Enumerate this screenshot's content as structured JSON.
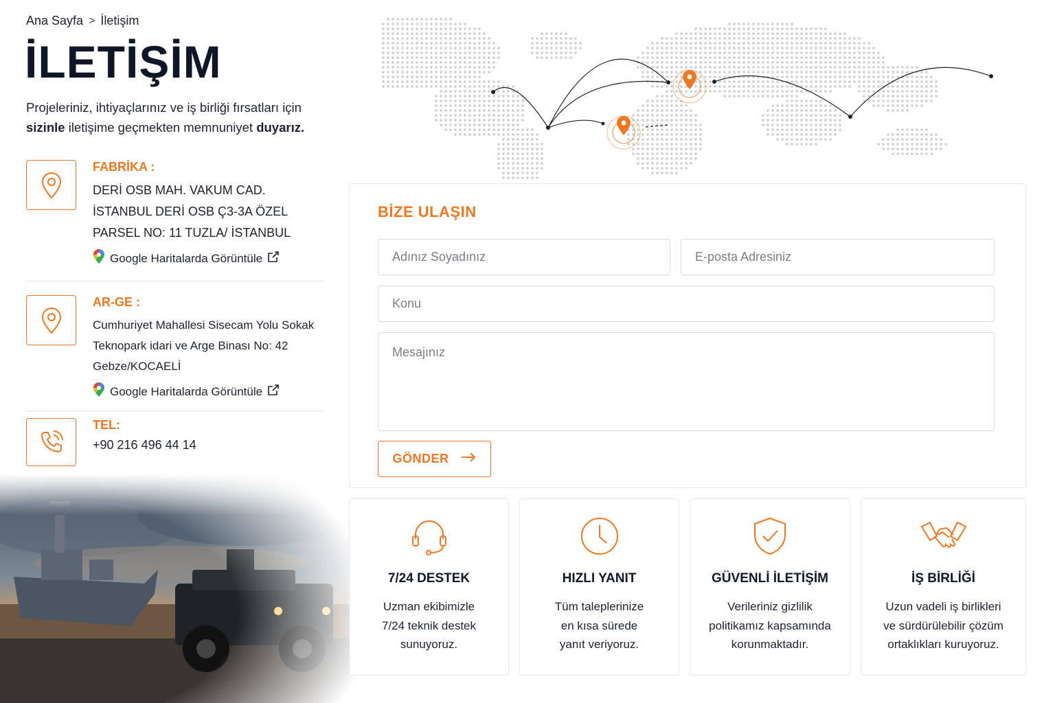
{
  "breadcrumb": {
    "home": "Ana Sayfa",
    "separator": ">",
    "current": "İletişim"
  },
  "page": {
    "title": "İLETİŞİM",
    "intro_line1": "Projeleriniz, ihtiyaçlarınız ve iş birliği fırsatları için",
    "intro_bold1": "sizinle",
    "intro_mid": "iletişime geçmekten memnuniyet",
    "intro_bold2": "duyarız."
  },
  "contacts": {
    "factory": {
      "icon": "location-pin-icon",
      "label": "FABRİKA :",
      "lines": [
        "DERİ OSB MAH. VAKUM CAD.",
        "İSTANBUL DERİ OSB Ç3-3A ÖZEL",
        "PARSEL NO: 11 TUZLA/ İSTANBUL"
      ],
      "maps_link": "Google Haritalarda Görüntüle"
    },
    "rnd": {
      "icon": "location-pin-icon",
      "label": "AR-GE :",
      "lines": [
        "Cumhuriyet Mahallesi Sisecam Yolu Sokak",
        "Teknopark idari ve Arge Binası No: 42",
        "Gebze/KOCAELİ"
      ],
      "maps_link": "Google Haritalarda Görüntüle"
    },
    "phone": {
      "icon": "phone-icon",
      "label": "TEL:",
      "number": "+90 216 496 44 14"
    }
  },
  "form": {
    "title": "BİZE ULAŞIN",
    "name_placeholder": "Adınız Soyadınız",
    "email_placeholder": "E-posta Adresiniz",
    "subject_placeholder": "Konu",
    "message_placeholder": "Mesajınız",
    "submit_label": "GÖNDER"
  },
  "features": [
    {
      "icon": "headset-icon",
      "title": "7/24 DESTEK",
      "lines": [
        "Uzman ekibimizle",
        "7/24 teknik destek",
        "sunuyoruz."
      ]
    },
    {
      "icon": "clock-icon",
      "title": "HIZLI YANIT",
      "lines": [
        "Tüm taleplerinize",
        "en kısa sürede",
        "yanıt veriyoruz."
      ]
    },
    {
      "icon": "shield-check-icon",
      "title": "GÜVENLİ İLETİŞİM",
      "lines": [
        "Verileriniz gizlilik",
        "politikamız kapsamında",
        "korunmaktadır."
      ]
    },
    {
      "icon": "handshake-icon",
      "title": "İŞ BİRLİĞİ",
      "lines": [
        "Uzun vadeli iş birlikleri",
        "ve sürdürülebilir çözüm",
        "ortaklıkları kuruyoruz."
      ]
    }
  ],
  "colors": {
    "accent": "#f07722",
    "text": "#1c2230",
    "border": "#e4e6ea"
  }
}
